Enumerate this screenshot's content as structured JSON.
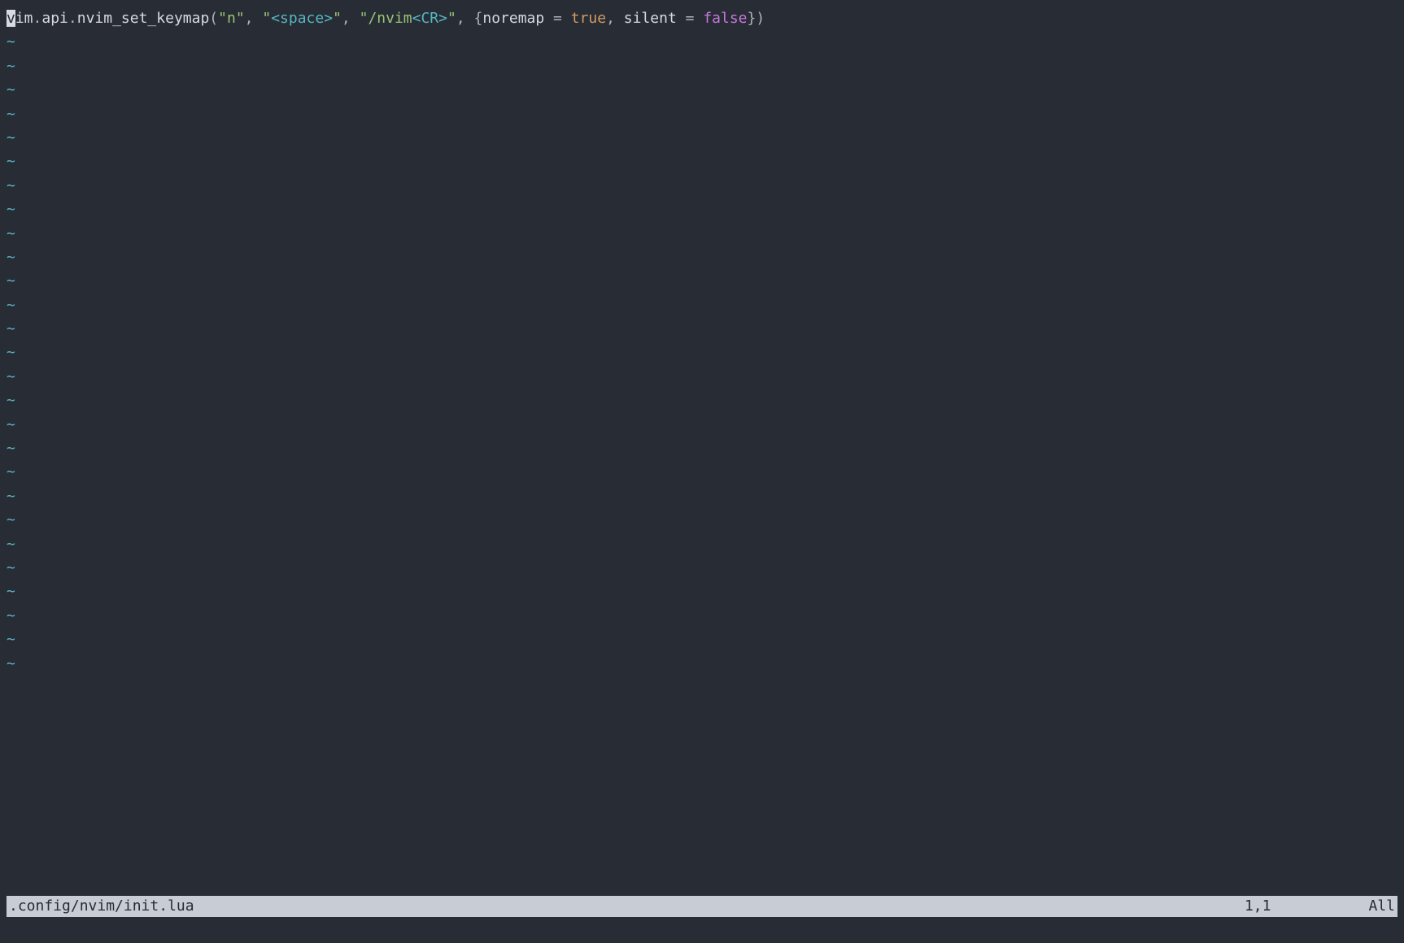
{
  "code": {
    "tokens": [
      {
        "cls": "cursor",
        "t": "v"
      },
      {
        "cls": "default",
        "t": "im"
      },
      {
        "cls": "punc",
        "t": "."
      },
      {
        "cls": "default",
        "t": "api"
      },
      {
        "cls": "punc",
        "t": "."
      },
      {
        "cls": "default",
        "t": "nvim_set_keymap"
      },
      {
        "cls": "punc",
        "t": "("
      },
      {
        "cls": "string-quote",
        "t": "\""
      },
      {
        "cls": "string-green",
        "t": "n"
      },
      {
        "cls": "string-quote",
        "t": "\""
      },
      {
        "cls": "punc",
        "t": ", "
      },
      {
        "cls": "string-quote",
        "t": "\""
      },
      {
        "cls": "special-cyan",
        "t": "<space>"
      },
      {
        "cls": "string-quote",
        "t": "\""
      },
      {
        "cls": "punc",
        "t": ", "
      },
      {
        "cls": "string-quote",
        "t": "\""
      },
      {
        "cls": "string-green",
        "t": "/nvim"
      },
      {
        "cls": "special-cyan",
        "t": "<CR>"
      },
      {
        "cls": "string-quote",
        "t": "\""
      },
      {
        "cls": "punc",
        "t": ", "
      },
      {
        "cls": "punc",
        "t": "{"
      },
      {
        "cls": "field",
        "t": "noremap"
      },
      {
        "cls": "punc",
        "t": " = "
      },
      {
        "cls": "bool-true",
        "t": "true"
      },
      {
        "cls": "punc",
        "t": ", "
      },
      {
        "cls": "field",
        "t": "silent"
      },
      {
        "cls": "punc",
        "t": " = "
      },
      {
        "cls": "bool-false",
        "t": "false"
      },
      {
        "cls": "punc",
        "t": "}"
      },
      {
        "cls": "punc",
        "t": ")"
      }
    ]
  },
  "tilde": "~",
  "tilde_count": 27,
  "status": {
    "filename": ".config/nvim/init.lua",
    "position": "1,1",
    "percent": "All"
  }
}
